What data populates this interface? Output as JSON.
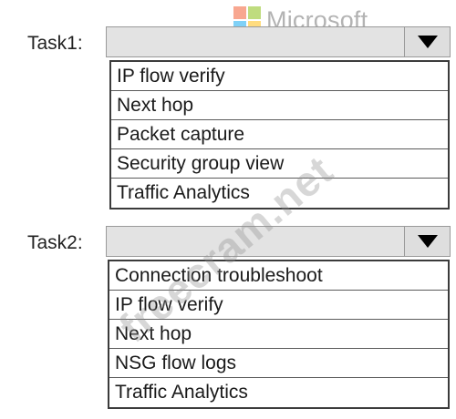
{
  "branding": {
    "logo_text": "Microsoft",
    "logo_colors": [
      "#f25022",
      "#7fba00",
      "#00a4ef",
      "#ffb900"
    ],
    "watermark_text": "freecram.net"
  },
  "tasks": [
    {
      "label": "Task1:",
      "selected_value": "",
      "options": [
        "IP flow verify",
        "Next hop",
        "Packet capture",
        "Security group view",
        "Traffic Analytics"
      ]
    },
    {
      "label": "Task2:",
      "selected_value": "",
      "options": [
        "Connection troubleshoot",
        "IP flow verify",
        "Next hop",
        "NSG flow logs",
        "Traffic Analytics"
      ]
    }
  ],
  "icons": {
    "dropdown": "caret-down-icon",
    "logo": "microsoft-logo-icon"
  }
}
